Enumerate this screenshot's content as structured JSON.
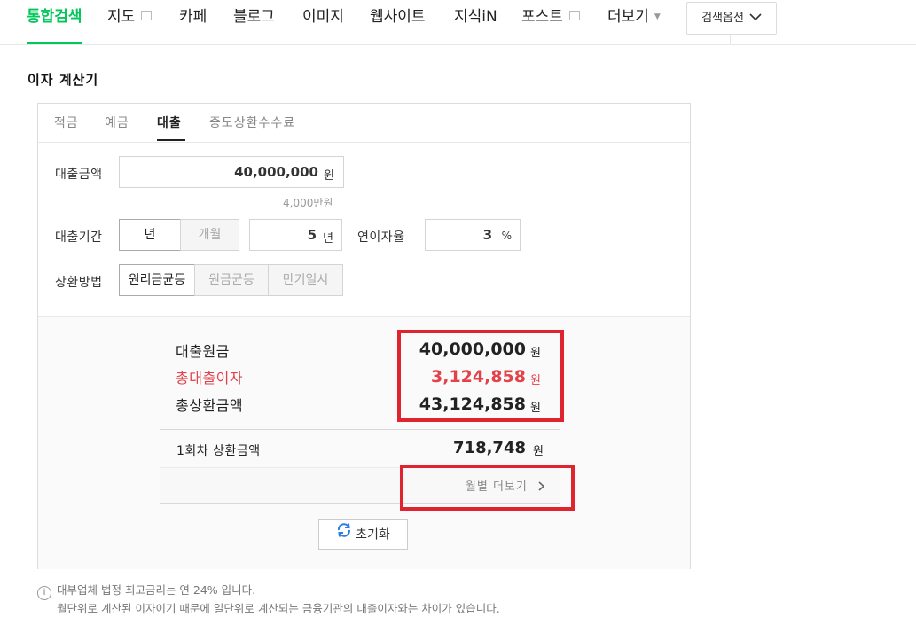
{
  "nav": {
    "tabs": [
      {
        "label": "통합검색"
      },
      {
        "label": "지도"
      },
      {
        "label": "카페"
      },
      {
        "label": "블로그"
      },
      {
        "label": "이미지"
      },
      {
        "label": "웹사이트"
      },
      {
        "label": "지식iN"
      },
      {
        "label": "포스트"
      },
      {
        "label": "더보기"
      }
    ],
    "search_option_label": "검색옵션"
  },
  "calculator": {
    "title": "이자 계산기",
    "tabs": [
      "적금",
      "예금",
      "대출",
      "중도상환수수료"
    ],
    "loan_amount_label": "대출금액",
    "loan_amount_value": "40,000,000",
    "loan_amount_unit": "원",
    "loan_amount_sub": "4,000만원",
    "period_label": "대출기간",
    "period_unit_year": "년",
    "period_unit_month": "개월",
    "period_value": "5",
    "period_value_unit": "년",
    "rate_label": "연이자율",
    "rate_value": "3",
    "rate_unit": "%",
    "method_label": "상환방법",
    "methods": [
      "원리금균등",
      "원금균등",
      "만기일시"
    ],
    "result": {
      "principal_label": "대출원금",
      "principal_value": "40,000,000",
      "interest_label": "총대출이자",
      "interest_value": "3,124,858",
      "total_label": "총상환금액",
      "total_value": "43,124,858",
      "won": "원",
      "installment_label": "1회차 상환금액",
      "installment_value": "718,748",
      "more_label": "월별 더보기",
      "reset_label": "초기화"
    }
  },
  "notes": [
    "대부업체 법정 최고금리는 연 24% 입니다.",
    "월단위로 계산된 이자이기 때문에 일단위로 계산되는 금융기관의 대출이자와는 차이가 있습니다."
  ],
  "colors": {
    "accent": "#03c75a",
    "highlight": "#e0242f",
    "interest": "#e2424a"
  }
}
